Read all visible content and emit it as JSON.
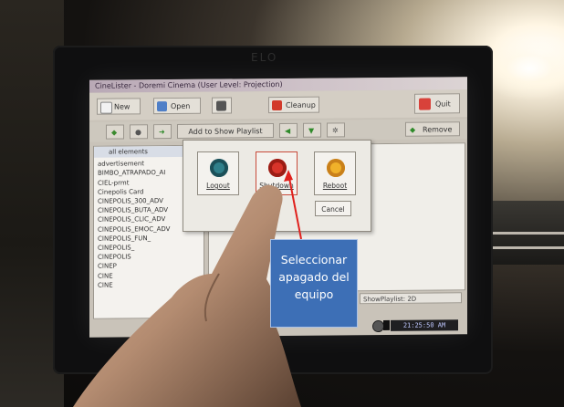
{
  "window": {
    "title": "CineLister - Doremi Cinema (User Level: Projection)"
  },
  "monitor_brand": "ELO",
  "toolbar": {
    "new_label": "New",
    "open_label": "Open",
    "cleanup_label": "Cleanup",
    "quit_label": "Quit"
  },
  "row2": {
    "add_label": "Add to Show Playlist",
    "remove_label": "Remove"
  },
  "content_list": {
    "header": "all elements",
    "items": [
      "advertisement",
      "BIMBO_ATRAPADO_AI",
      "CIEL-prmt",
      "Cinepolis Card",
      "CINEPOLIS_300_ADV",
      "CINEPOLIS_BUTA_ADV",
      "CINEPOLIS_CLIC_ADV",
      "CINEPOLIS_EMOC_ADV",
      "CINEPOLIS_FUN_",
      "CINEPOLIS_",
      "CINEPOLIS",
      "CINEP",
      "CINE",
      "CINE"
    ]
  },
  "show_playlist_label": "ShowPlaylist: 2D",
  "clock_text": "21:25:50 AM",
  "dialog": {
    "logout_label": "Logout",
    "shutdown_label": "Shutdown",
    "reboot_label": "Reboot",
    "cancel_label": "Cancel"
  },
  "annotation": {
    "lines": [
      "Seleccionar",
      "apagado del",
      "equipo"
    ],
    "box_color": "#3d6fb6",
    "arrow_color": "#e0201c"
  }
}
